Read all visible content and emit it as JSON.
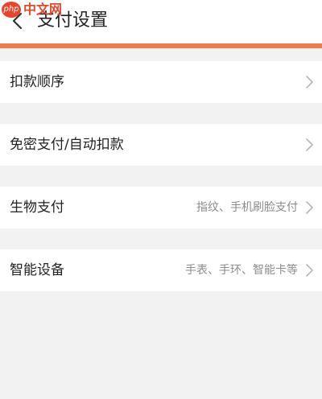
{
  "header": {
    "title": "支付设置",
    "accent_color": "#f07a4c"
  },
  "watermark": {
    "logo_text": "php",
    "text": "中文网"
  },
  "rows": [
    {
      "label": "扣款顺序",
      "value": "",
      "icon": "chevron-right-icon"
    },
    {
      "label": "免密支付/自动扣款",
      "value": "",
      "icon": "chevron-right-icon"
    },
    {
      "label": "生物支付",
      "value": "指纹、手机刷脸支付",
      "icon": "chevron-right-icon"
    },
    {
      "label": "智能设备",
      "value": "手表、手环、智能卡等",
      "icon": "chevron-right-icon"
    }
  ]
}
